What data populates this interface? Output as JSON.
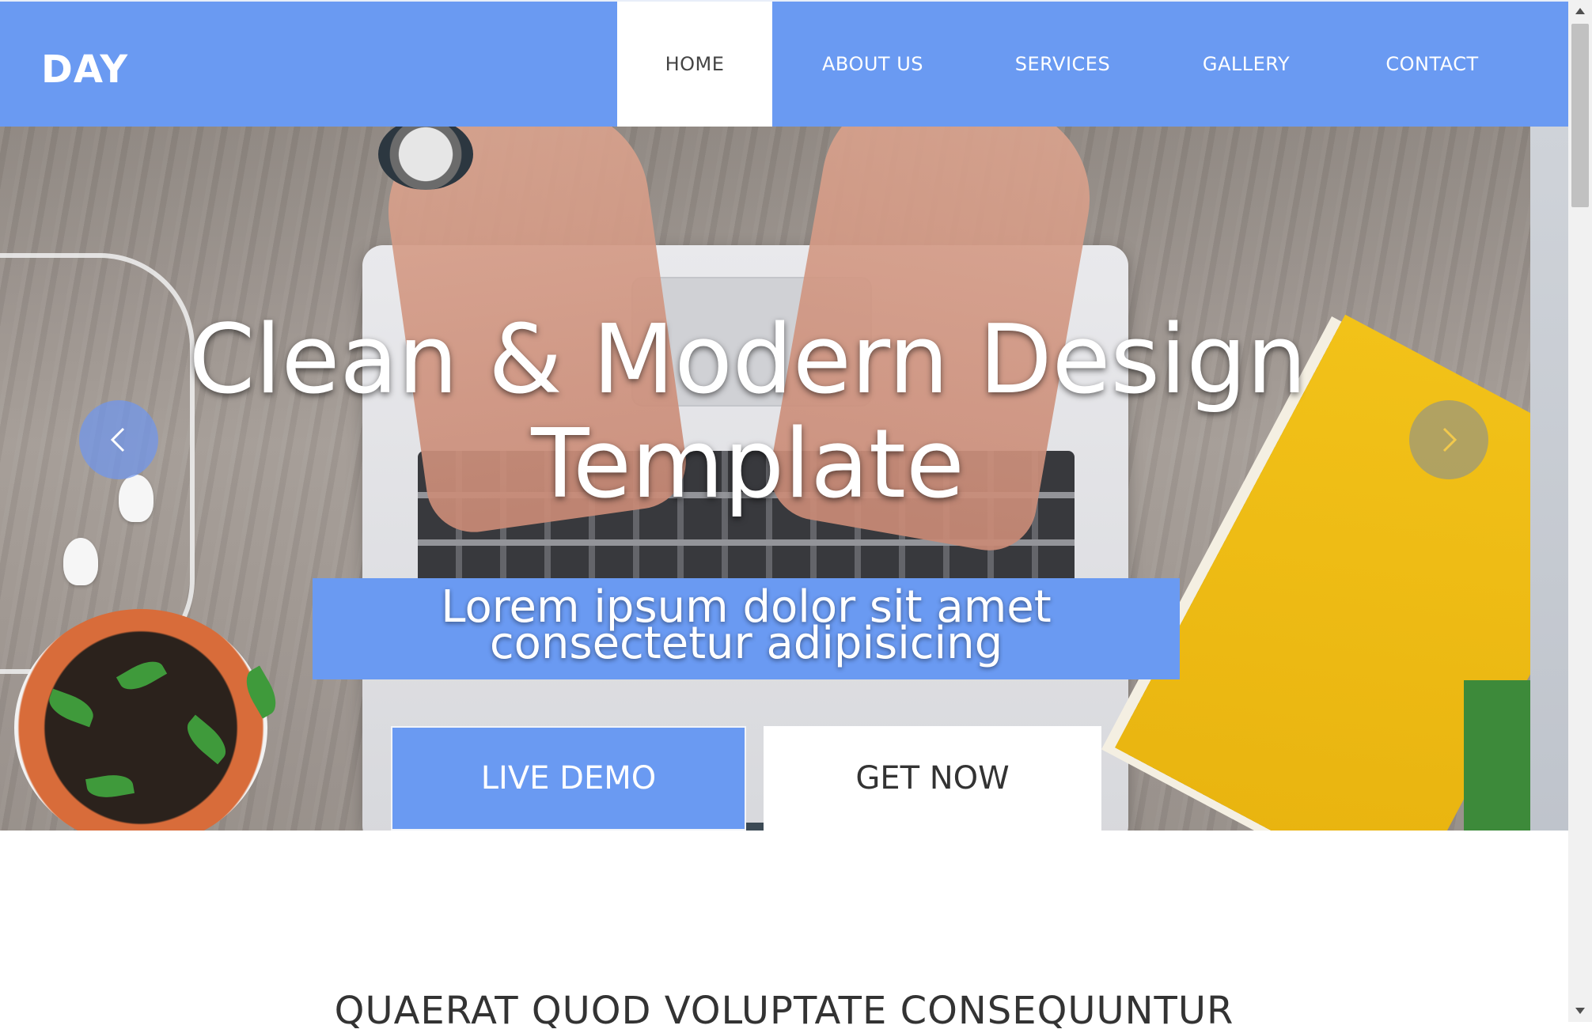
{
  "brand": {
    "logo_text": "DAY",
    "accent_color": "#6a9af2"
  },
  "nav": {
    "items": [
      {
        "label": "HOME",
        "active": true
      },
      {
        "label": "ABOUT US",
        "active": false
      },
      {
        "label": "SERVICES",
        "active": false
      },
      {
        "label": "GALLERY",
        "active": false
      },
      {
        "label": "CONTACT",
        "active": false
      }
    ]
  },
  "hero": {
    "title_line1": "Clean & Modern Design",
    "title_line2": "Template",
    "subtitle_line1": "Lorem ipsum dolor sit amet",
    "subtitle_line2": "consectetur adipisicing",
    "buttons": {
      "live_demo": "LIVE DEMO",
      "get_now": "GET NOW"
    },
    "carousel": {
      "prev_icon": "chevron-left-icon",
      "next_icon": "chevron-right-icon"
    }
  },
  "section": {
    "title": "QUAERAT QUOD VOLUPTATE CONSEQUUNTUR"
  }
}
